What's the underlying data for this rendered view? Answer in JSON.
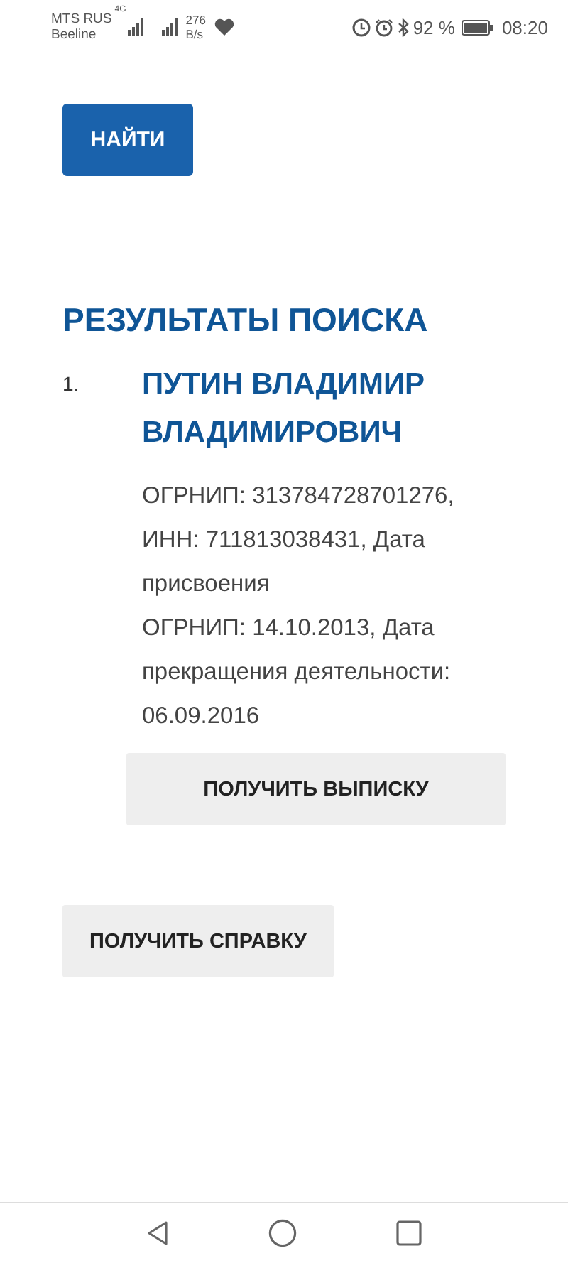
{
  "status_bar": {
    "carrier_1": "MTS RUS",
    "carrier_2": "Beeline",
    "network": "4G",
    "speed_value": "276",
    "speed_unit": "B/s",
    "battery": "92 %",
    "time": "08:20"
  },
  "search_button": "НАЙТИ",
  "results_title": "РЕЗУЛЬТАТЫ ПОИСКА",
  "results": [
    {
      "number": "1.",
      "name": "ПУТИН ВЛАДИМИР ВЛАДИМИРОВИЧ",
      "details": [
        "ОГРНИП: 313784728701276, ИНН: 711813038431, Дата присвоения",
        "ОГРНИП: 14.10.2013, Дата прекращения деятельности: 06.09.2016"
      ],
      "button": "ПОЛУЧИТЬ ВЫПИСКУ"
    }
  ],
  "certificate_button": "ПОЛУЧИТЬ СПРАВКУ"
}
